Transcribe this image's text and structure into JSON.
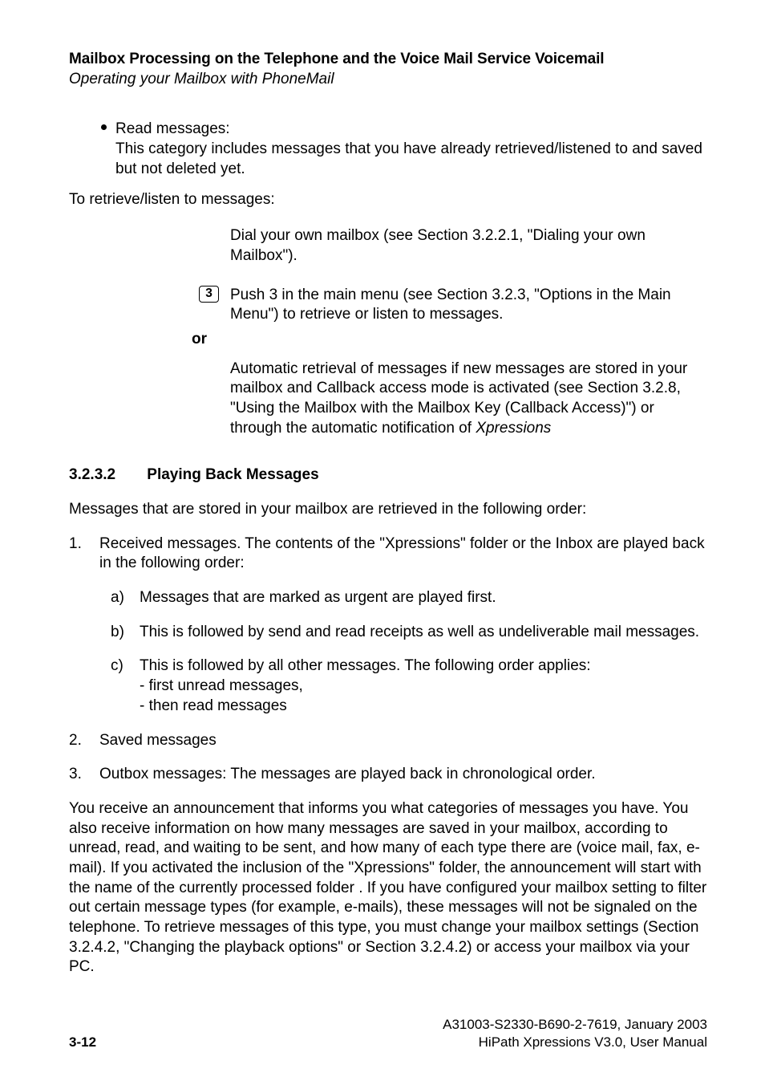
{
  "header": {
    "title": "Mailbox Processing on the Telephone and the Voice Mail Service Voicemail",
    "subtitle": "Operating your Mailbox with PhoneMail"
  },
  "bullet_read": {
    "label": "Read messages:",
    "body": "This category includes messages that you have already retrieved/listened to and saved but not deleted yet."
  },
  "retrieve_lead": "To retrieve/listen to messages:",
  "steps": {
    "dial": "Dial your own mailbox (see Section 3.2.2.1, \"Dialing your own Mailbox\").",
    "push3_key": "3",
    "push3_text": "Push 3 in the main menu (see Section 3.2.3, \"Options in the Main Menu\") to retrieve or listen to messages.",
    "or_label": "or",
    "auto_pre": "Automatic retrieval of messages if new messages are stored in your mailbox and Callback access mode is activated (see Section 3.2.8, \"Using the Mailbox with the Mailbox Key (Callback Access)\") or through the automatic notification of ",
    "auto_italic": "Xpressions"
  },
  "sec_322": {
    "num": "3.2.3.2",
    "title": "Playing Back Messages"
  },
  "p_after_h": "Messages that are stored in your mailbox are retrieved in the following order:",
  "ol": {
    "n1": "1.",
    "t1": "Received messages. The contents of the \"Xpressions\" folder or the Inbox are played back in the following order:",
    "a_n": "a)",
    "a_t": "Messages that are marked as urgent are played first.",
    "b_n": "b)",
    "b_t": "This is followed by send and read receipts as well as undeliverable mail messages.",
    "c_n": "c)",
    "c_t": "This is followed by all other messages. The following order applies:",
    "c_l1": "- first unread messages,",
    "c_l2": "- then read messages",
    "n2": "2.",
    "t2": "Saved messages",
    "n3": "3.",
    "t3": "Outbox messages: The messages are played back in chronological order."
  },
  "big_para": "You receive an announcement that informs you what categories of messages you have. You also receive information on how many messages are saved in your mailbox, according to unread, read, and waiting to be sent, and how many of each type there are (voice mail, fax, e-mail). If you activated the inclusion of the \"Xpressions\" folder, the announcement will start with the name of the currently processed folder . If you have configured your mailbox setting to filter out certain message types (for example, e-mails), these messages will not be signaled on the telephone. To retrieve messages of this type, you must change your mailbox settings (Section 3.2.4.2, \"Changing the playback options\" or Section 3.2.4.2) or access your mailbox via your PC.",
  "footer": {
    "doc_id": "A31003-S2330-B690-2-7619, January 2003",
    "product": "HiPath Xpressions V3.0, User Manual",
    "page": "3-12"
  }
}
